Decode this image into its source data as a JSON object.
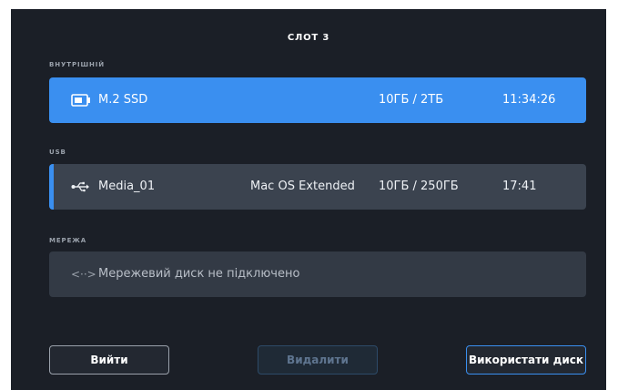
{
  "screen": {
    "title": "СЛОТ 3"
  },
  "sections": {
    "internal_label": "ВНУТРІШНІЙ",
    "usb_label": "USB",
    "network_label": "МЕРЕЖА"
  },
  "internal_drive": {
    "icon": "ssd-icon",
    "name": "M.2 SSD",
    "format": "",
    "usage": "10ГБ / 2ТБ",
    "time": "11:34:26",
    "selected": true
  },
  "usb_drive": {
    "icon": "usb-icon",
    "name": "Media_01",
    "format": "Mac OS Extended",
    "usage": "10ГБ / 250ГБ",
    "time": "17:41"
  },
  "network_drive": {
    "icon": "network-link-icon",
    "icon_glyph": "<··>",
    "status": "Мережевий диск не підключено"
  },
  "buttons": {
    "exit": "Вийти",
    "delete": "Видалити",
    "use_disk": "Використати диск"
  },
  "colors": {
    "accent": "#3a8ff0",
    "background": "#1b1f27",
    "row": "#3b434f"
  }
}
